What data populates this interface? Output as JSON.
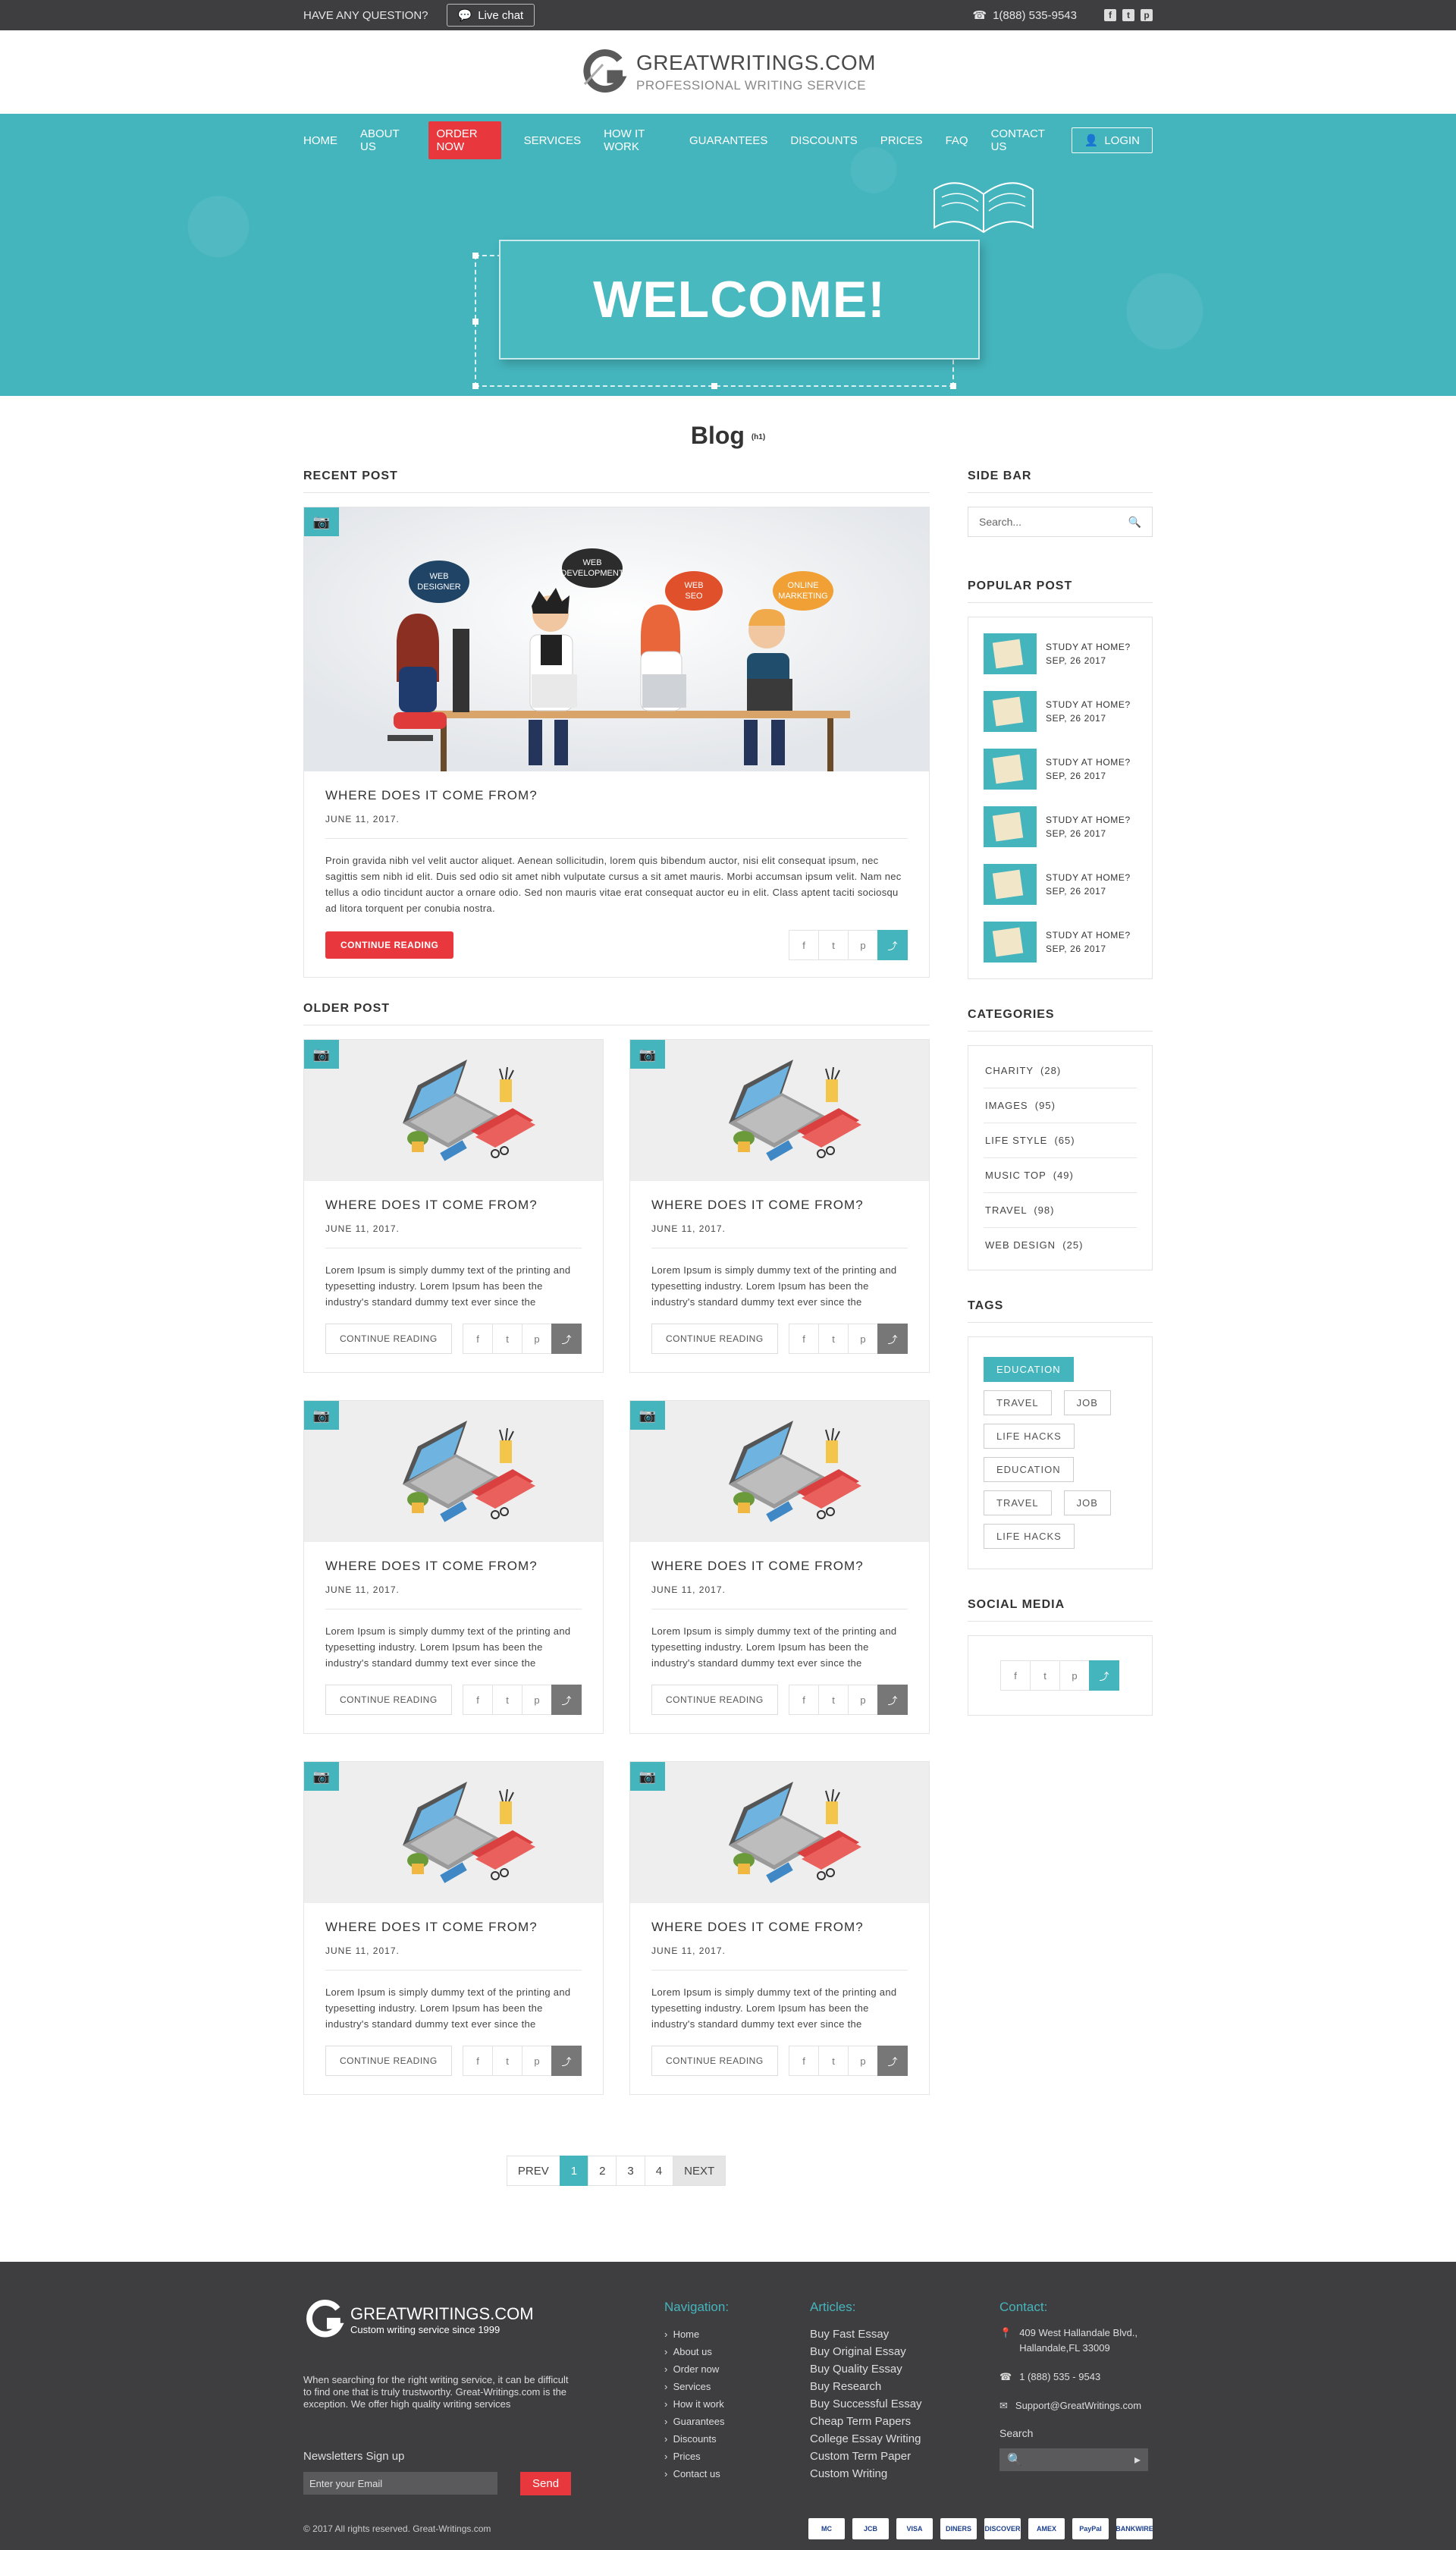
{
  "topbar": {
    "question": "HAVE ANY QUESTION?",
    "livechat": "Live chat",
    "phone": "1(888) 535-9543",
    "social": [
      "f",
      "t",
      "p"
    ]
  },
  "header": {
    "logo_title": "GREATWRITINGS.COM",
    "logo_subtitle": "PROFESSIONAL WRITING SERVICE"
  },
  "nav": {
    "items": [
      "HOME",
      "ABOUT US",
      "ORDER NOW",
      "SERVICES",
      "HOW IT WORK",
      "GUARANTEES",
      "DISCOUNTS",
      "PRICES",
      "FAQ",
      "CONTACT US"
    ],
    "login": "LOGIN"
  },
  "hero": {
    "title": "WELCOME!"
  },
  "blog": {
    "title": "Blog",
    "title_tag": "(h1)",
    "recent_heading": "RECENT POST",
    "older_heading": "OLDER POST",
    "recent": {
      "bubbles": [
        "WEB DESIGNER",
        "WEB DEVELOPMENT",
        "WEB SEO",
        "ONLINE MARKETING"
      ],
      "title": "WHERE DOES IT COME FROM?",
      "date": "JUNE 11, 2017.",
      "text": "Proin gravida nibh vel velit auctor aliquet. Aenean sollicitudin, lorem quis bibendum auctor, nisi elit consequat ipsum, nec sagittis sem nibh id elit. Duis sed odio sit amet nibh vulputate cursus a sit amet mauris. Morbi accumsan ipsum velit. Nam nec tellus a odio tincidunt auctor a ornare odio. Sed non mauris vitae erat consequat auctor eu in elit. Class aptent taciti sociosqu ad litora torquent per conubia nostra.",
      "button": "CONTINUE READING"
    },
    "older": [
      {
        "title": "WHERE DOES IT COME FROM?",
        "date": "JUNE 11, 2017.",
        "text": "Lorem Ipsum is simply dummy text of the printing and typesetting industry. Lorem Ipsum has been the industry's standard dummy text ever since the",
        "button": "CONTINUE READING"
      },
      {
        "title": "WHERE DOES IT COME FROM?",
        "date": "JUNE 11, 2017.",
        "text": "Lorem Ipsum is simply dummy text of the printing and typesetting industry. Lorem Ipsum has been the industry's standard dummy text ever since the",
        "button": "CONTINUE READING"
      },
      {
        "title": "WHERE DOES IT COME FROM?",
        "date": "JUNE 11, 2017.",
        "text": "Lorem Ipsum is simply dummy text of the printing and typesetting industry. Lorem Ipsum has been the industry's standard dummy text ever since the",
        "button": "CONTINUE READING"
      },
      {
        "title": "WHERE DOES IT COME FROM?",
        "date": "JUNE 11, 2017.",
        "text": "Lorem Ipsum is simply dummy text of the printing and typesetting industry. Lorem Ipsum has been the industry's standard dummy text ever since the",
        "button": "CONTINUE READING"
      },
      {
        "title": "WHERE DOES IT COME FROM?",
        "date": "JUNE 11, 2017.",
        "text": "Lorem Ipsum is simply dummy text of the printing and typesetting industry. Lorem Ipsum has been the industry's standard dummy text ever since the",
        "button": "CONTINUE READING"
      },
      {
        "title": "WHERE DOES IT COME FROM?",
        "date": "JUNE 11, 2017.",
        "text": "Lorem Ipsum is simply dummy text of the printing and typesetting industry. Lorem Ipsum has been the industry's standard dummy text ever since the",
        "button": "CONTINUE READING"
      }
    ],
    "pager": {
      "prev": "PREV",
      "pages": [
        "1",
        "2",
        "3",
        "4"
      ],
      "next": "NEXT",
      "active": "1"
    }
  },
  "sidebar": {
    "heading": "SIDE BAR",
    "search_placeholder": "Search...",
    "popular_heading": "POPULAR POST",
    "popular": [
      {
        "title": "STUDY AT HOME?",
        "date": "SEP, 26 2017"
      },
      {
        "title": "STUDY AT HOME?",
        "date": "SEP, 26 2017"
      },
      {
        "title": "STUDY AT HOME?",
        "date": "SEP, 26 2017"
      },
      {
        "title": "STUDY AT HOME?",
        "date": "SEP, 26 2017"
      },
      {
        "title": "STUDY AT HOME?",
        "date": "SEP, 26 2017"
      },
      {
        "title": "STUDY AT HOME?",
        "date": "SEP, 26 2017"
      }
    ],
    "categories_heading": "CATEGORIES",
    "categories": [
      "CHARITY  (28)",
      "IMAGES  (95)",
      "LIFE STYLE  (65)",
      "MUSIC TOP  (49)",
      "TRAVEL  (98)",
      "WEB DESIGN  (25)"
    ],
    "tags_heading": "TAGS",
    "tags": [
      "EDUCATION",
      "TRAVEL",
      "JOB",
      "LIFE HACKS",
      "EDUCATION",
      "TRAVEL",
      "JOB",
      "LIFE HACKS"
    ],
    "social_heading": "SOCIAL MEDIA"
  },
  "footer": {
    "logo_title": "GREATWRITINGS.COM",
    "logo_subtitle": "Custom writing service since 1999",
    "description": "When searching for the right writing service, it can be difficult to find one that is truly trustworthy. Great-Writings.com is the exception. We offer high quality writing services",
    "newsletter_label": "Newsletters Sign up",
    "email_placeholder": "Enter your Email",
    "send": "Send",
    "nav_heading": "Navigation:",
    "nav_items": [
      "Home",
      "About us",
      "Order now",
      "Services",
      "How it work",
      "Guarantees",
      "Discounts",
      "Prices",
      "Contact us"
    ],
    "articles_heading": "Articles:",
    "articles": [
      "Buy Fast Essay",
      "Buy Original Essay",
      "Buy Quality Essay",
      "Buy Research",
      "Buy Successful Essay",
      "Cheap Term Papers",
      "College Essay Writing",
      "Custom Term Paper",
      "Custom Writing"
    ],
    "contact_heading": "Contact:",
    "address": "409 West Hallandale Blvd., Hallandale,FL 33009",
    "phone": "1 (888) 535 - 9543",
    "email": "Support@GreatWritings.com",
    "search_label": "Search",
    "copyright": "© 2017 All rights reserved. Great-Writings.com",
    "payments": [
      "MC",
      "JCB",
      "VISA",
      "DINERS",
      "DISCOVER",
      "AMEX",
      "PayPal",
      "BANKWIRE"
    ]
  },
  "colors": {
    "accent": "#45b5bd",
    "red": "#e8383e",
    "dark": "#3e3e40"
  }
}
